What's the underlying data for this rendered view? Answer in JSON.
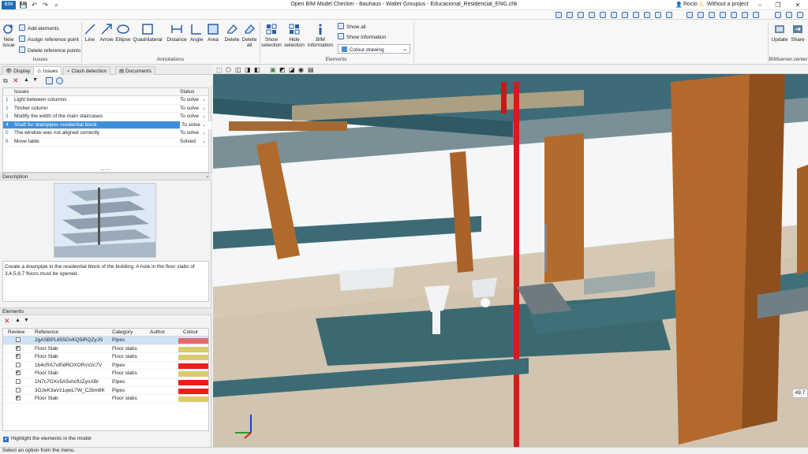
{
  "window": {
    "title": "Open BIM Model Checker - Bauhaus - Walter Groupius - Educacional_Residencial_ENG.chk",
    "user": "Rocio",
    "project_status": "Without a project"
  },
  "ribbon": {
    "issues_group": {
      "label": "Issues",
      "new_issue": "New issue",
      "add_elements": "Add elements",
      "assign_reference_point": "Assign reference point",
      "delete_reference_points": "Delete reference points"
    },
    "annotations_group": {
      "label": "Annotations",
      "line": "Line",
      "arrow": "Arrow",
      "ellipse": "Ellipse",
      "quadrilateral": "Quadrilateral",
      "distance": "Distance",
      "angle": "Angle",
      "area": "Area",
      "delete": "Delete",
      "delete_all": "Delete all"
    },
    "elements_group": {
      "label": "Elements",
      "show_selection": "Show selection",
      "hide_selection": "Hide selection",
      "bim_information": "BIM information",
      "show_all": "Show all",
      "show_information": "Show information",
      "colour_mode": "Colour drawing"
    },
    "bimserver_group": {
      "label": "BIMserver.center",
      "update": "Update",
      "share": "Share"
    }
  },
  "left_tabs": {
    "display": "Display",
    "issues": "Issues",
    "clash_detection": "Clash detection",
    "documents": "Documents"
  },
  "issues_table": {
    "col_issues": "Issues",
    "col_status": "Status",
    "rows": [
      {
        "num": "1",
        "name": "Light between columns",
        "status": "To solve"
      },
      {
        "num": "2",
        "name": "Timber column",
        "status": "To solve"
      },
      {
        "num": "3",
        "name": "Modify the width of the main staircases",
        "status": "To solve"
      },
      {
        "num": "4",
        "name": "Shaft for drainpipes residential block",
        "status": "To solve"
      },
      {
        "num": "5",
        "name": "The window was not aligned correctly",
        "status": "To solve"
      },
      {
        "num": "6",
        "name": "Move table",
        "status": "Solved"
      }
    ]
  },
  "description": {
    "header": "Description",
    "text": "Create a downpipe in the residential block of the building. A hole in the floor slabs of 3,4,5,6,7 floors must be opened."
  },
  "elements": {
    "header": "Elements",
    "col_review": "Review",
    "col_reference": "Reference",
    "col_category": "Category",
    "col_author": "Author",
    "col_colour": "Colour",
    "rows": [
      {
        "checked": false,
        "reference": "2gASBPL655OvKQ5iRQZyJS",
        "category": "Pipes",
        "author": "",
        "colour": "#e46a6a"
      },
      {
        "checked": true,
        "reference": "Floor Slab",
        "category": "Floor slabs",
        "author": "",
        "colour": "#d9cc6a"
      },
      {
        "checked": true,
        "reference": "Floor Slab",
        "category": "Floor slabs",
        "author": "",
        "colour": "#d9cc6a"
      },
      {
        "checked": false,
        "reference": "1b4cRA7uf0dROXORsVzc7V",
        "category": "Pipes",
        "author": "",
        "colour": "#ee1c1c"
      },
      {
        "checked": true,
        "reference": "Floor Slab",
        "category": "Floor slabs",
        "author": "",
        "colour": "#d9cc6a"
      },
      {
        "checked": false,
        "reference": "1N7c7OXv5A5vhcfUZyoXBr",
        "category": "Pipes",
        "author": "",
        "colour": "#ee1c1c"
      },
      {
        "checked": false,
        "reference": "3OJeK3aVz1qwL7W_C2bm8K",
        "category": "Pipes",
        "author": "",
        "colour": "#ee1c1c"
      },
      {
        "checked": true,
        "reference": "Floor Slab",
        "category": "Floor slabs",
        "author": "",
        "colour": "#d9cc6a"
      }
    ],
    "highlight_label": "Highlight the elements in the model"
  },
  "viewport": {
    "scale_readout": "49.7"
  },
  "status_bar": {
    "text": "Select an option from the menu."
  }
}
